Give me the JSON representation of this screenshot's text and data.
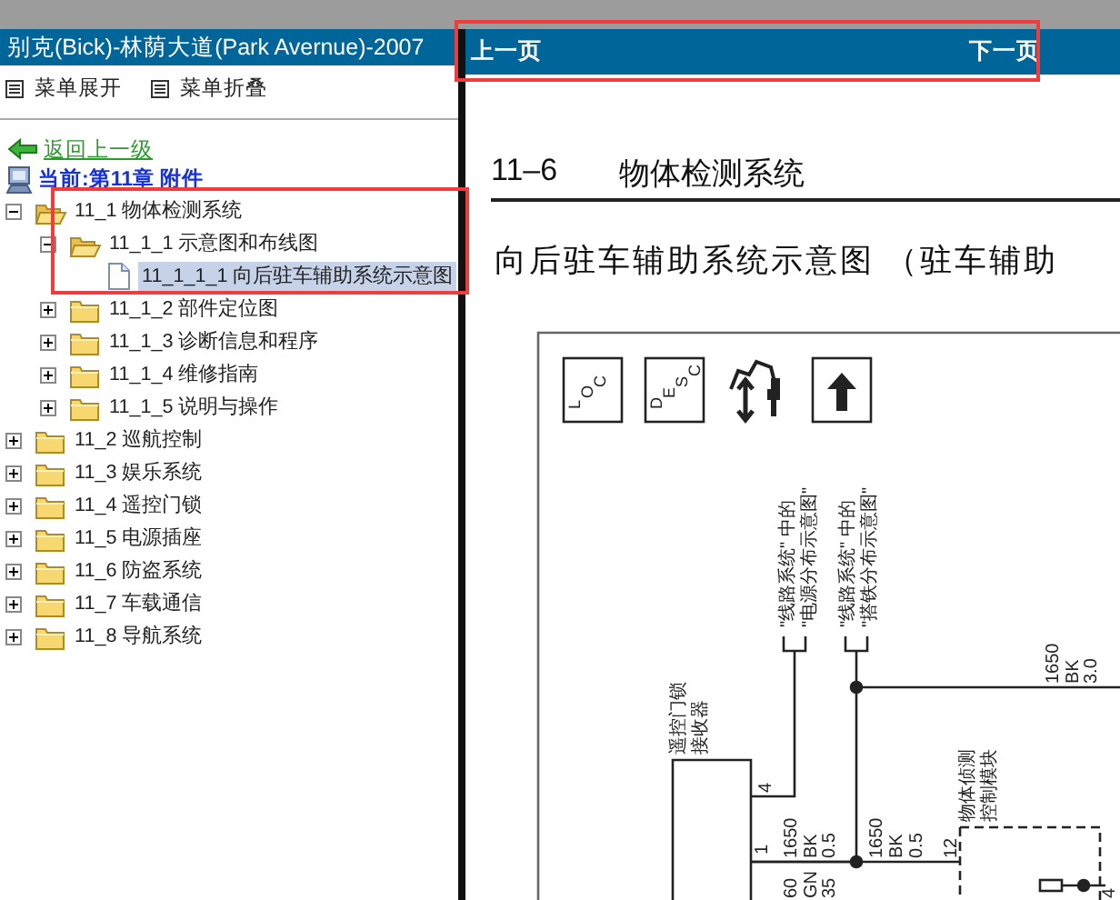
{
  "left_pane": {
    "title": "别克(Bick)-林荫大道(Park Avernue)-2007",
    "menu": [
      {
        "label": "菜单展开"
      },
      {
        "label": "菜单折叠"
      }
    ],
    "back_link": "返回上一级",
    "current": "当前:第11章 附件",
    "tree": [
      {
        "label": "11_1 物体检测系统",
        "kind": "folder",
        "expanded": true,
        "selected": false,
        "children": [
          {
            "label": "11_1_1 示意图和布线图",
            "kind": "folder",
            "expanded": true,
            "selected": false,
            "children": [
              {
                "label": "11_1_1_1 向后驻车辅助系统示意图",
                "kind": "document",
                "selected": true
              }
            ]
          },
          {
            "label": "11_1_2 部件定位图",
            "kind": "folder",
            "expanded": false,
            "selected": false
          },
          {
            "label": "11_1_3 诊断信息和程序",
            "kind": "folder",
            "expanded": false,
            "selected": false
          },
          {
            "label": "11_1_4 维修指南",
            "kind": "folder",
            "expanded": false,
            "selected": false
          },
          {
            "label": "11_1_5 说明与操作",
            "kind": "folder",
            "expanded": false,
            "selected": false
          }
        ]
      },
      {
        "label": "11_2 巡航控制",
        "kind": "folder",
        "expanded": false,
        "selected": false
      },
      {
        "label": "11_3 娱乐系统",
        "kind": "folder",
        "expanded": false,
        "selected": false
      },
      {
        "label": "11_4 遥控门锁",
        "kind": "folder",
        "expanded": false,
        "selected": false
      },
      {
        "label": "11_5 电源插座",
        "kind": "folder",
        "expanded": false,
        "selected": false
      },
      {
        "label": "11_6 防盗系统",
        "kind": "folder",
        "expanded": false,
        "selected": false
      },
      {
        "label": "11_7 车载通信",
        "kind": "folder",
        "expanded": false,
        "selected": false
      },
      {
        "label": "11_8 导航系统",
        "kind": "folder",
        "expanded": false,
        "selected": false
      }
    ]
  },
  "page_nav": {
    "prev": "上一页",
    "next": "下一页"
  },
  "document": {
    "section_number": "11–6",
    "section_title": "物体检测系统",
    "heading": "向后驻车辅助系统示意图 （驻车辅助",
    "diagram": {
      "symbols": [
        {
          "kind": "letters",
          "letters": [
            "L",
            "O",
            "C"
          ]
        },
        {
          "kind": "letters",
          "letters": [
            "D",
            "E",
            "S",
            "C"
          ]
        },
        {
          "kind": "service"
        },
        {
          "kind": "arrow"
        }
      ],
      "labels": [
        "\"线路系统\" 中的",
        "\"电源分布示意图\"",
        "\"线路系统\" 中的",
        "\"搭铁分布示意图\"",
        "遥控门锁",
        "接收器",
        "4",
        "1",
        "1650",
        "BK",
        "0.5",
        "1650",
        "BK",
        "0.5",
        "12",
        "物体侦测",
        "控制模块",
        "1650",
        "BK",
        "3.0",
        "60",
        "GN",
        "35",
        "4"
      ]
    }
  }
}
